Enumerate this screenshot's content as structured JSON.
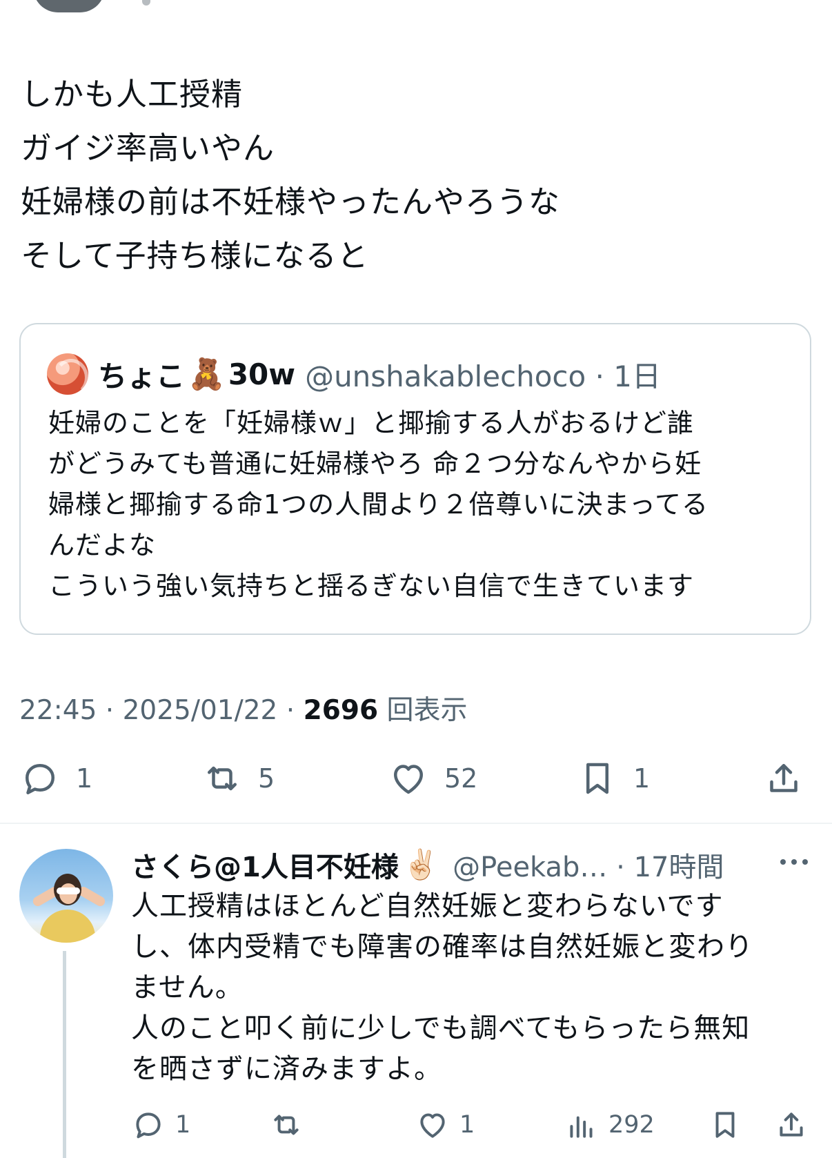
{
  "tweet": {
    "lines": [
      "しかも人工授精",
      "ガイジ率高いやん",
      "妊婦様の前は不妊様やったんやろうな",
      "そして子持ち様になると"
    ]
  },
  "quote": {
    "name": "ちょこ",
    "name_emoji": "🧸",
    "name_suffix": "30w",
    "handle_time": "@unshakablechoco · 1日",
    "lines": [
      "妊婦のことを「妊婦様ｗ」と揶揄する人がおるけど誰",
      "がどうみても普通に妊婦様やろ 命２つ分なんやから妊",
      "婦様と揶揄する命1つの人間より２倍尊いに決まってる",
      "んだよな",
      "こういう強い気持ちと揺るぎない自信で生きています"
    ]
  },
  "meta": {
    "time_date": "22:45 · 2025/01/22 · ",
    "views_count": "2696",
    "views_label": " 回表示"
  },
  "actions": {
    "replies": "1",
    "reposts": "5",
    "likes": "52",
    "bookmarks": "1"
  },
  "reply": {
    "name": "さくら@1人目不妊様",
    "name_emoji": "✌🏻",
    "handle_time": "@Peekab… · 17時間",
    "lines": [
      "人工授精はほとんど自然妊娠と変わらないです",
      "し、体内受精でも障害の確率は自然妊娠と変わり",
      "ません。",
      "人のこと叩く前に少しでも調べてもらったら無知",
      "を晒さずに済みますよ。"
    ],
    "actions": {
      "replies": "1",
      "likes": "1",
      "views": "292"
    }
  },
  "colors": {
    "text": "#0f1419",
    "secondary": "#536471",
    "border": "#cfd9de"
  }
}
